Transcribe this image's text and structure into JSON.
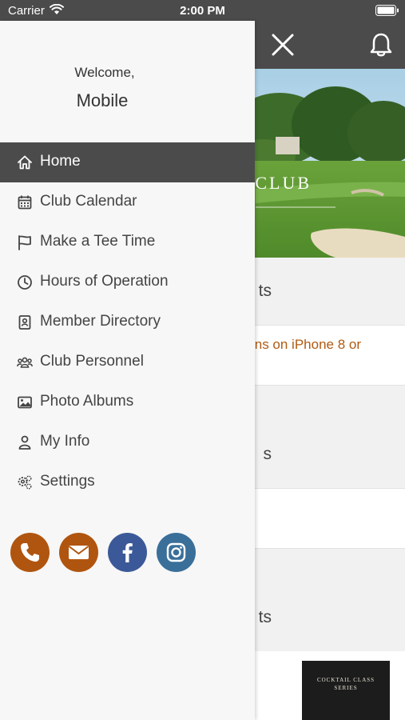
{
  "status_bar": {
    "carrier": "Carrier",
    "time": "2:00 PM"
  },
  "header": {
    "close_icon": "close-icon",
    "bell_icon": "bell-icon"
  },
  "hero": {
    "text": "N CLUB"
  },
  "sections": [
    {
      "title": "ts"
    },
    {
      "title": "s"
    },
    {
      "title": "ts"
    }
  ],
  "notice": {
    "line1": "ns on iPhone 8 or"
  },
  "poster": {
    "line1": "COCKTAIL CLASS",
    "line2": "SERIES"
  },
  "drawer": {
    "welcome": "Welcome,",
    "username": "Mobile",
    "menu": [
      {
        "label": "Home",
        "icon": "home-icon",
        "active": true
      },
      {
        "label": "Club Calendar",
        "icon": "calendar-icon",
        "active": false
      },
      {
        "label": "Make a Tee Time",
        "icon": "flag-icon",
        "active": false
      },
      {
        "label": "Hours of Operation",
        "icon": "clock-icon",
        "active": false
      },
      {
        "label": "Member Directory",
        "icon": "contact-book-icon",
        "active": false
      },
      {
        "label": "Club Personnel",
        "icon": "people-icon",
        "active": false
      },
      {
        "label": "Photo Albums",
        "icon": "image-icon",
        "active": false
      },
      {
        "label": "My Info",
        "icon": "user-icon",
        "active": false
      },
      {
        "label": "Settings",
        "icon": "gear-icon",
        "active": false
      }
    ],
    "social": [
      {
        "icon": "phone-icon",
        "color": "#b0550f"
      },
      {
        "icon": "envelope-icon",
        "color": "#b0550f"
      },
      {
        "icon": "facebook-icon",
        "color": "#3b5998"
      },
      {
        "icon": "instagram-icon",
        "color": "#3a6f99"
      }
    ]
  },
  "colors": {
    "header": "#4b4b4b",
    "accent": "#b05a12",
    "drawer_bg": "#f7f7f7"
  }
}
